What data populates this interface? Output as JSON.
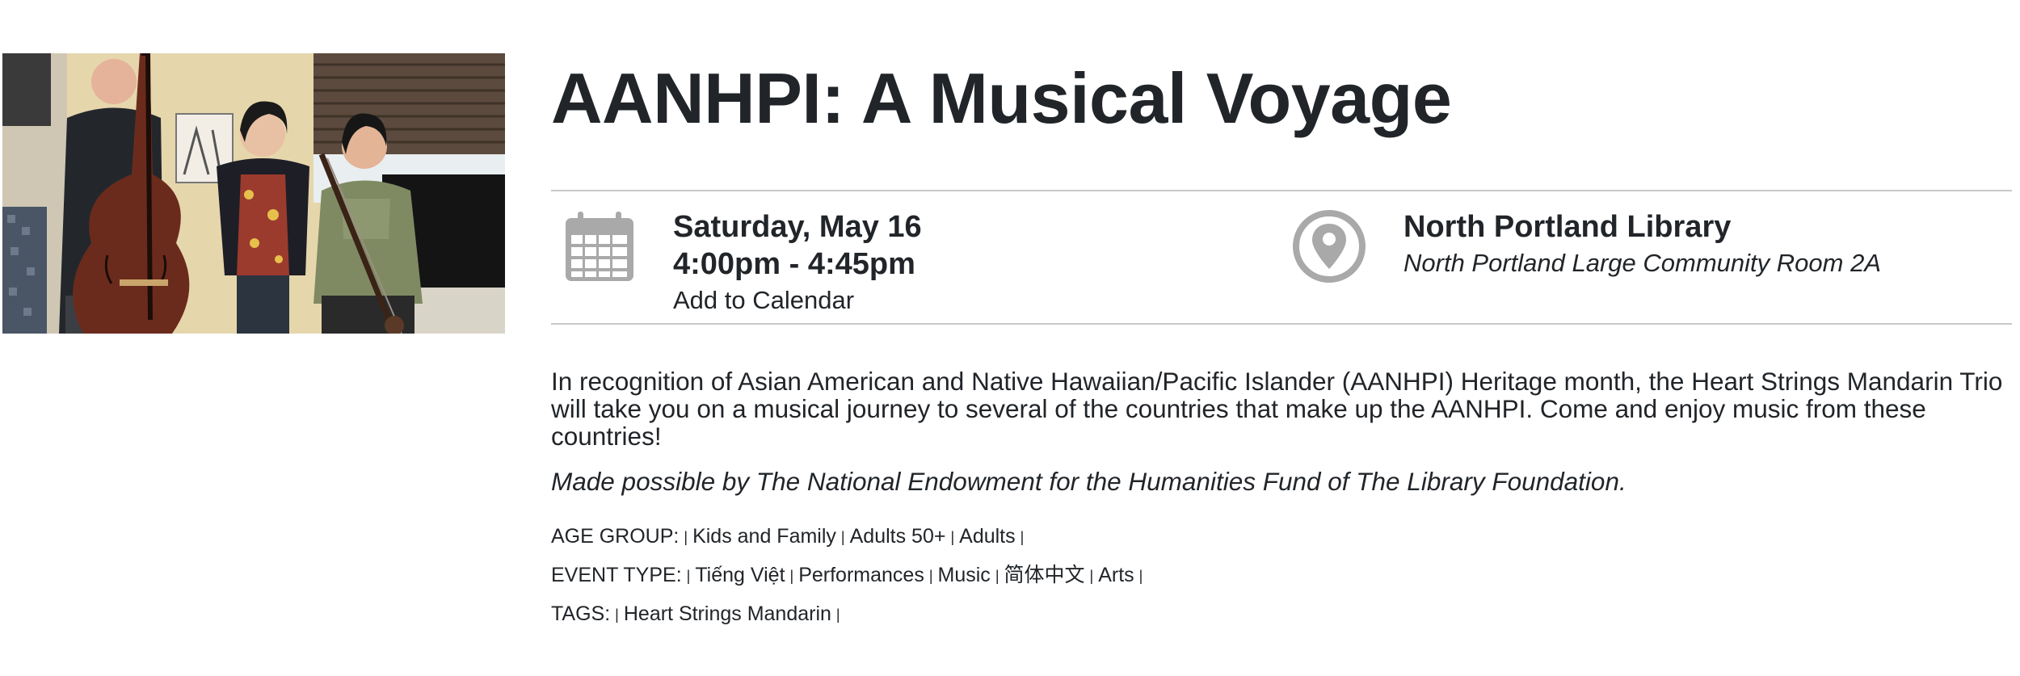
{
  "event": {
    "title": "AANHPI: A Musical Voyage",
    "date": "Saturday, May 16",
    "time": "4:00pm - 4:45pm",
    "add_to_calendar": "Add to Calendar",
    "location_name": "North Portland Library",
    "location_room": "North Portland Large Community Room 2A",
    "description": "In recognition of Asian American and Native Hawaiian/Pacific Islander (AANHPI) Heritage month, the Heart Strings Mandarin Trio will take you on a musical journey to several of the countries that make up the AANHPI. Come and enjoy music from these countries!",
    "credit": "Made possible by The National Endowment for the Humanities Fund of The Library Foundation."
  },
  "meta": {
    "age_group_label": "AGE GROUP:",
    "age_groups": [
      "Kids and Family",
      "Adults 50+",
      "Adults"
    ],
    "event_type_label": "EVENT TYPE:",
    "event_types": [
      "Tiếng Việt",
      "Performances",
      "Music",
      "简体中文",
      "Arts"
    ],
    "tags_label": "TAGS:",
    "tags": [
      "Heart Strings Mandarin"
    ]
  },
  "icons": {
    "calendar": "calendar-icon",
    "location": "map-pin-icon"
  },
  "colors": {
    "text": "#212529",
    "icon_gray": "#a9a9a9",
    "rule": "#c8c8c8"
  }
}
